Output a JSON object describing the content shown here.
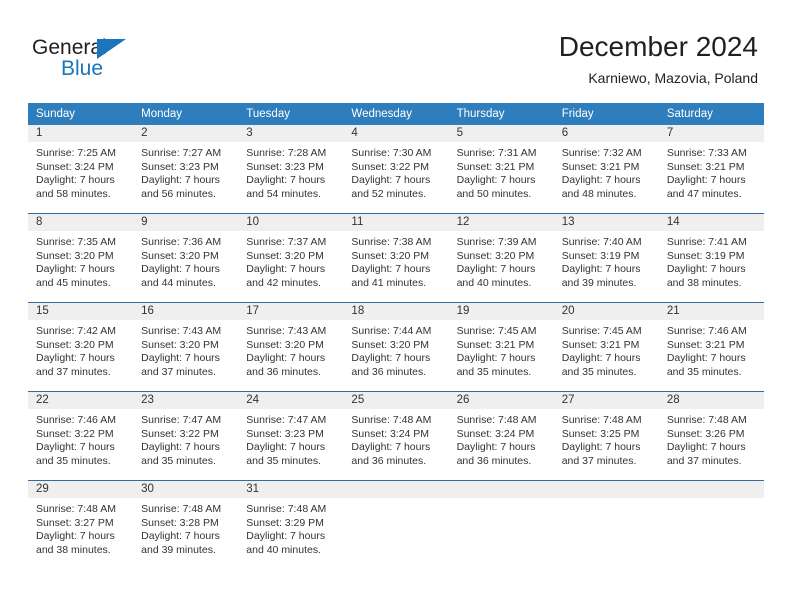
{
  "brand": {
    "name_part1": "General",
    "name_part2": "Blue",
    "triangle_color": "#1b75bb"
  },
  "header": {
    "title": "December 2024",
    "subtitle": "Karniewo, Mazovia, Poland"
  },
  "theme": {
    "header_row_bg": "#2e7ebd",
    "week_divider": "#2e6da4",
    "daynum_bg": "#efefef",
    "text": "#333333"
  },
  "weekdays": [
    "Sunday",
    "Monday",
    "Tuesday",
    "Wednesday",
    "Thursday",
    "Friday",
    "Saturday"
  ],
  "weeks": [
    [
      {
        "day": "1",
        "sunrise": "Sunrise: 7:25 AM",
        "sunset": "Sunset: 3:24 PM",
        "daylight1": "Daylight: 7 hours",
        "daylight2": "and 58 minutes."
      },
      {
        "day": "2",
        "sunrise": "Sunrise: 7:27 AM",
        "sunset": "Sunset: 3:23 PM",
        "daylight1": "Daylight: 7 hours",
        "daylight2": "and 56 minutes."
      },
      {
        "day": "3",
        "sunrise": "Sunrise: 7:28 AM",
        "sunset": "Sunset: 3:23 PM",
        "daylight1": "Daylight: 7 hours",
        "daylight2": "and 54 minutes."
      },
      {
        "day": "4",
        "sunrise": "Sunrise: 7:30 AM",
        "sunset": "Sunset: 3:22 PM",
        "daylight1": "Daylight: 7 hours",
        "daylight2": "and 52 minutes."
      },
      {
        "day": "5",
        "sunrise": "Sunrise: 7:31 AM",
        "sunset": "Sunset: 3:21 PM",
        "daylight1": "Daylight: 7 hours",
        "daylight2": "and 50 minutes."
      },
      {
        "day": "6",
        "sunrise": "Sunrise: 7:32 AM",
        "sunset": "Sunset: 3:21 PM",
        "daylight1": "Daylight: 7 hours",
        "daylight2": "and 48 minutes."
      },
      {
        "day": "7",
        "sunrise": "Sunrise: 7:33 AM",
        "sunset": "Sunset: 3:21 PM",
        "daylight1": "Daylight: 7 hours",
        "daylight2": "and 47 minutes."
      }
    ],
    [
      {
        "day": "8",
        "sunrise": "Sunrise: 7:35 AM",
        "sunset": "Sunset: 3:20 PM",
        "daylight1": "Daylight: 7 hours",
        "daylight2": "and 45 minutes."
      },
      {
        "day": "9",
        "sunrise": "Sunrise: 7:36 AM",
        "sunset": "Sunset: 3:20 PM",
        "daylight1": "Daylight: 7 hours",
        "daylight2": "and 44 minutes."
      },
      {
        "day": "10",
        "sunrise": "Sunrise: 7:37 AM",
        "sunset": "Sunset: 3:20 PM",
        "daylight1": "Daylight: 7 hours",
        "daylight2": "and 42 minutes."
      },
      {
        "day": "11",
        "sunrise": "Sunrise: 7:38 AM",
        "sunset": "Sunset: 3:20 PM",
        "daylight1": "Daylight: 7 hours",
        "daylight2": "and 41 minutes."
      },
      {
        "day": "12",
        "sunrise": "Sunrise: 7:39 AM",
        "sunset": "Sunset: 3:20 PM",
        "daylight1": "Daylight: 7 hours",
        "daylight2": "and 40 minutes."
      },
      {
        "day": "13",
        "sunrise": "Sunrise: 7:40 AM",
        "sunset": "Sunset: 3:19 PM",
        "daylight1": "Daylight: 7 hours",
        "daylight2": "and 39 minutes."
      },
      {
        "day": "14",
        "sunrise": "Sunrise: 7:41 AM",
        "sunset": "Sunset: 3:19 PM",
        "daylight1": "Daylight: 7 hours",
        "daylight2": "and 38 minutes."
      }
    ],
    [
      {
        "day": "15",
        "sunrise": "Sunrise: 7:42 AM",
        "sunset": "Sunset: 3:20 PM",
        "daylight1": "Daylight: 7 hours",
        "daylight2": "and 37 minutes."
      },
      {
        "day": "16",
        "sunrise": "Sunrise: 7:43 AM",
        "sunset": "Sunset: 3:20 PM",
        "daylight1": "Daylight: 7 hours",
        "daylight2": "and 37 minutes."
      },
      {
        "day": "17",
        "sunrise": "Sunrise: 7:43 AM",
        "sunset": "Sunset: 3:20 PM",
        "daylight1": "Daylight: 7 hours",
        "daylight2": "and 36 minutes."
      },
      {
        "day": "18",
        "sunrise": "Sunrise: 7:44 AM",
        "sunset": "Sunset: 3:20 PM",
        "daylight1": "Daylight: 7 hours",
        "daylight2": "and 36 minutes."
      },
      {
        "day": "19",
        "sunrise": "Sunrise: 7:45 AM",
        "sunset": "Sunset: 3:21 PM",
        "daylight1": "Daylight: 7 hours",
        "daylight2": "and 35 minutes."
      },
      {
        "day": "20",
        "sunrise": "Sunrise: 7:45 AM",
        "sunset": "Sunset: 3:21 PM",
        "daylight1": "Daylight: 7 hours",
        "daylight2": "and 35 minutes."
      },
      {
        "day": "21",
        "sunrise": "Sunrise: 7:46 AM",
        "sunset": "Sunset: 3:21 PM",
        "daylight1": "Daylight: 7 hours",
        "daylight2": "and 35 minutes."
      }
    ],
    [
      {
        "day": "22",
        "sunrise": "Sunrise: 7:46 AM",
        "sunset": "Sunset: 3:22 PM",
        "daylight1": "Daylight: 7 hours",
        "daylight2": "and 35 minutes."
      },
      {
        "day": "23",
        "sunrise": "Sunrise: 7:47 AM",
        "sunset": "Sunset: 3:22 PM",
        "daylight1": "Daylight: 7 hours",
        "daylight2": "and 35 minutes."
      },
      {
        "day": "24",
        "sunrise": "Sunrise: 7:47 AM",
        "sunset": "Sunset: 3:23 PM",
        "daylight1": "Daylight: 7 hours",
        "daylight2": "and 35 minutes."
      },
      {
        "day": "25",
        "sunrise": "Sunrise: 7:48 AM",
        "sunset": "Sunset: 3:24 PM",
        "daylight1": "Daylight: 7 hours",
        "daylight2": "and 36 minutes."
      },
      {
        "day": "26",
        "sunrise": "Sunrise: 7:48 AM",
        "sunset": "Sunset: 3:24 PM",
        "daylight1": "Daylight: 7 hours",
        "daylight2": "and 36 minutes."
      },
      {
        "day": "27",
        "sunrise": "Sunrise: 7:48 AM",
        "sunset": "Sunset: 3:25 PM",
        "daylight1": "Daylight: 7 hours",
        "daylight2": "and 37 minutes."
      },
      {
        "day": "28",
        "sunrise": "Sunrise: 7:48 AM",
        "sunset": "Sunset: 3:26 PM",
        "daylight1": "Daylight: 7 hours",
        "daylight2": "and 37 minutes."
      }
    ],
    [
      {
        "day": "29",
        "sunrise": "Sunrise: 7:48 AM",
        "sunset": "Sunset: 3:27 PM",
        "daylight1": "Daylight: 7 hours",
        "daylight2": "and 38 minutes."
      },
      {
        "day": "30",
        "sunrise": "Sunrise: 7:48 AM",
        "sunset": "Sunset: 3:28 PM",
        "daylight1": "Daylight: 7 hours",
        "daylight2": "and 39 minutes."
      },
      {
        "day": "31",
        "sunrise": "Sunrise: 7:48 AM",
        "sunset": "Sunset: 3:29 PM",
        "daylight1": "Daylight: 7 hours",
        "daylight2": "and 40 minutes."
      },
      {
        "day": "",
        "sunrise": "",
        "sunset": "",
        "daylight1": "",
        "daylight2": ""
      },
      {
        "day": "",
        "sunrise": "",
        "sunset": "",
        "daylight1": "",
        "daylight2": ""
      },
      {
        "day": "",
        "sunrise": "",
        "sunset": "",
        "daylight1": "",
        "daylight2": ""
      },
      {
        "day": "",
        "sunrise": "",
        "sunset": "",
        "daylight1": "",
        "daylight2": ""
      }
    ]
  ]
}
